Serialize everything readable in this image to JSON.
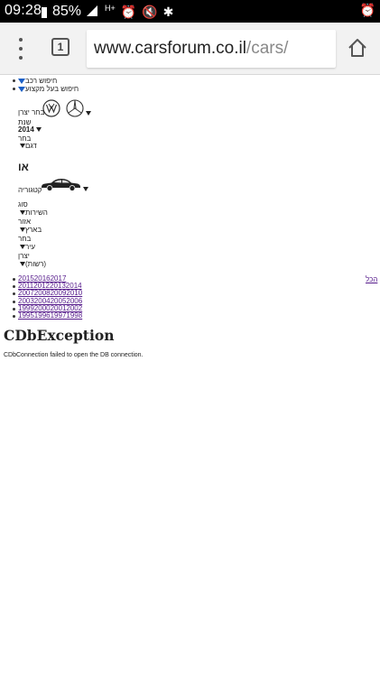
{
  "status_bar": {
    "time": "09:28",
    "battery": "85%",
    "network": "H+"
  },
  "browser": {
    "tab_count": "1",
    "url_host": "www.carsforum.co.il",
    "url_path": "/cars/"
  },
  "nav": {
    "search_vehicle": "חיפוש רכב",
    "search_by_owner": "חיפוש בעל מקצוע"
  },
  "filters": {
    "select_maker": "בחר יצרן",
    "year_label": "שנת",
    "year_value": "2014",
    "choose_label": "בחר",
    "model_label": "דגם",
    "or_label": "או",
    "category_label": "קטגוריה",
    "type_label": "סוג",
    "services_label": "השירות",
    "area_label": "אזור",
    "country_label": "בארץ",
    "choose_label_2": "בחר",
    "city_label": "עיר",
    "maker_label": "יצרן",
    "official_label": "(רשות)"
  },
  "year_links": [
    "201520162017",
    "2011201220132014",
    "2007200820092010",
    "2003200420052006",
    "1999200020012002",
    "1995199619971998"
  ],
  "all_link": "הכל",
  "error": {
    "title": "CDbException",
    "message": "CDbConnection failed to open the DB connection."
  }
}
